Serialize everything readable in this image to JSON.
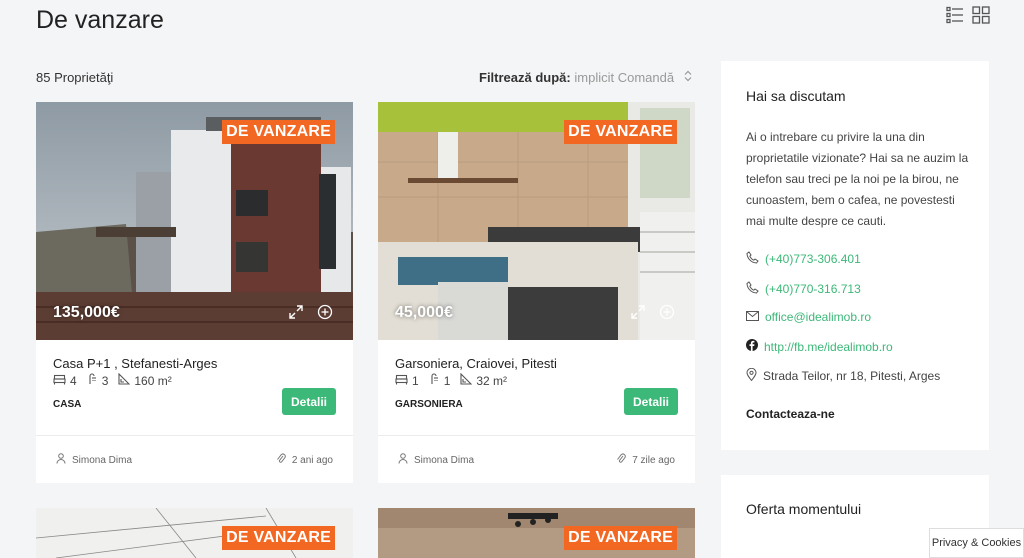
{
  "page_title": "De vanzare",
  "results_count": "85 Proprietăţi",
  "filter": {
    "label": "Filtrează după:",
    "value": "implicit Comandă"
  },
  "view_toggles": [
    "list-view-icon",
    "grid-view-icon"
  ],
  "colors": {
    "accent_green": "#3cb878",
    "badge_orange": "#f26722"
  },
  "listings": [
    {
      "badge": "DE VANZARE",
      "price": "135,000€",
      "title": "Casa P+1 , Stefanesti-Arges",
      "beds": "4",
      "baths": "3",
      "area": "160 m²",
      "type": "CASA",
      "details_label": "Detalii",
      "agent": "Simona Dima",
      "age": "2 ani ago"
    },
    {
      "badge": "DE VANZARE",
      "price": "45,000€",
      "title": "Garsoniera, Craiovei, Pitesti",
      "beds": "1",
      "baths": "1",
      "area": "32 m²",
      "type": "GARSONIERA",
      "details_label": "Detalii",
      "agent": "Simona Dima",
      "age": "7 zile ago"
    },
    {
      "badge": "DE VANZARE"
    },
    {
      "badge": "DE VANZARE"
    }
  ],
  "sidebar": {
    "contact": {
      "title": "Hai sa discutam",
      "text": "Ai o intrebare cu privire la una din proprietatile vizionate? Hai sa ne auzim la telefon sau treci pe la noi pe la birou, ne cunoastem, bem o cafea, ne povestesti mai multe despre ce cauti.",
      "phone1": "(+40)773-306.401",
      "phone2": "(+40)770-316.713",
      "email": "office@idealimob.ro",
      "facebook": "http://fb.me/idealimob.ro",
      "address": "Strada Teilor, nr 18, Pitesti, Arges",
      "cta": "Contacteaza-ne"
    },
    "offer": {
      "title": "Oferta momentului"
    }
  },
  "privacy_label": "Privacy & Cookies"
}
